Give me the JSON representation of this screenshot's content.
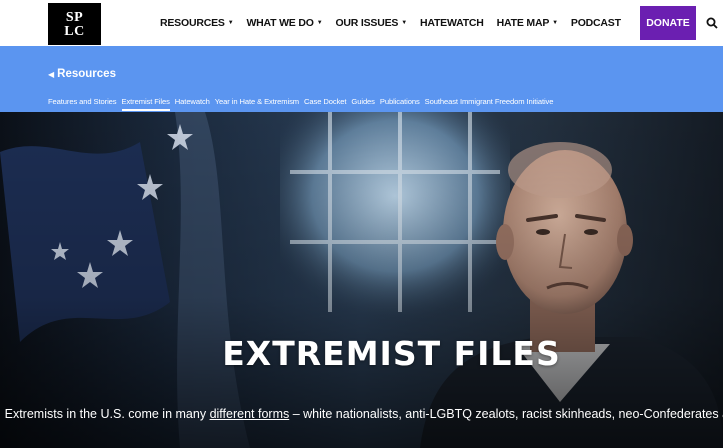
{
  "logo": {
    "line1": "SP",
    "line2": "LC"
  },
  "nav": {
    "items": [
      {
        "label": "RESOURCES",
        "dropdown": true
      },
      {
        "label": "WHAT WE DO",
        "dropdown": true
      },
      {
        "label": "OUR ISSUES",
        "dropdown": true
      },
      {
        "label": "HATEWATCH",
        "dropdown": false
      },
      {
        "label": "HATE MAP",
        "dropdown": true
      },
      {
        "label": "PODCAST",
        "dropdown": false
      }
    ],
    "donate": "DONATE",
    "search_icon": "search-icon"
  },
  "subnav": {
    "back_label": "Resources",
    "tabs": [
      {
        "label": "Features and Stories",
        "active": false
      },
      {
        "label": "Extremist Files",
        "active": true
      },
      {
        "label": "Hatewatch",
        "active": false
      },
      {
        "label": "Year in Hate & Extremism",
        "active": false
      },
      {
        "label": "Case Docket",
        "active": false
      },
      {
        "label": "Guides",
        "active": false
      },
      {
        "label": "Publications",
        "active": false
      },
      {
        "label": "Southeast Immigrant Freedom Initiative",
        "active": false
      }
    ]
  },
  "hero": {
    "title": "EXTREMIST FILES",
    "desc_before": "Extremists in the U.S. come in many ",
    "desc_link": "different forms",
    "desc_after": " – white nationalists, anti-LGBTQ zealots, racist skinheads, neo-Confederates and more."
  },
  "colors": {
    "subnav_blue": "#5b95f0",
    "donate_purple": "#6b1fb1",
    "logo_black": "#000000"
  }
}
